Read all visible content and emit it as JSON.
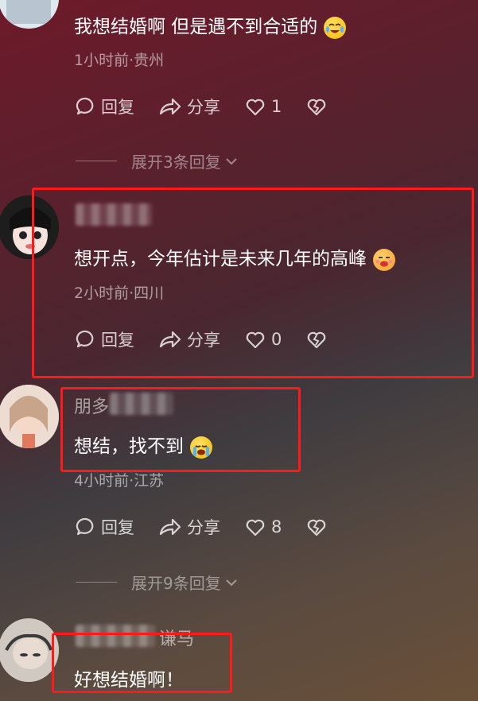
{
  "comments": [
    {
      "text": "我想结婚啊 但是遇不到合适的",
      "meta": "1小时前·贵州",
      "reply_label": "回复",
      "share_label": "分享",
      "likes": "1",
      "expand": "展开3条回复"
    },
    {
      "text": "想开点，今年估计是未来几年的高峰",
      "meta": "2小时前·四川",
      "reply_label": "回复",
      "share_label": "分享",
      "likes": "0"
    },
    {
      "username_partial": "朋多",
      "text": "想结，找不到",
      "meta": "4小时前·江苏",
      "reply_label": "回复",
      "share_label": "分享",
      "likes": "8",
      "expand": "展开9条回复"
    },
    {
      "username_partial": "谦马",
      "text": "好想结婚啊！"
    }
  ],
  "colors": {
    "highlight_box": "#ff1a1a",
    "emoji_yellow": "#f5b800"
  },
  "icons": {
    "reply": "comment-bubble-icon",
    "share": "share-arrow-icon",
    "like": "heart-icon",
    "dislike": "broken-heart-icon",
    "expand": "chevron-down-icon"
  }
}
